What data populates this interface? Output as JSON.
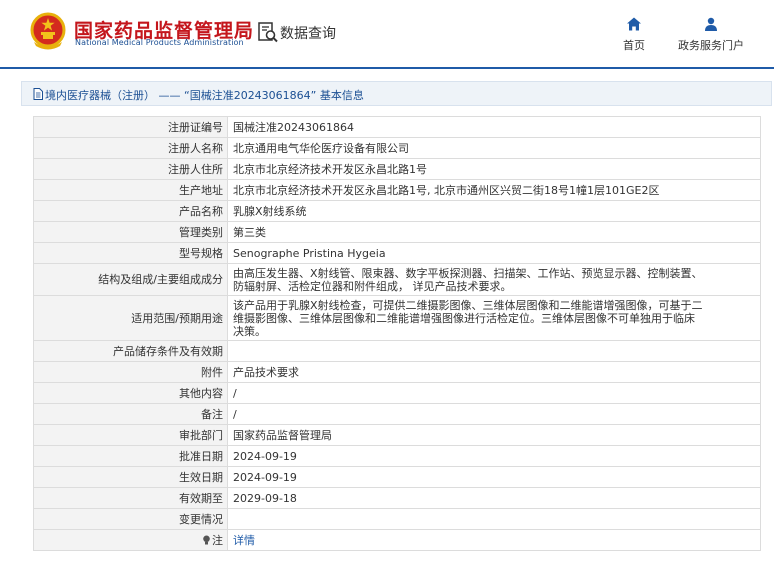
{
  "header": {
    "brand_cn": "国家药品监督管理局",
    "brand_en": "National Medical Products Administration",
    "query_label": "数据查询",
    "nav": {
      "home": "首页",
      "portal": "政务服务门户"
    }
  },
  "breadcrumb": {
    "text": "境内医疗器械（注册） —— “国械注准20243061864” 基本信息"
  },
  "detail": {
    "rows": [
      {
        "label": "注册证编号",
        "value": "国械注准20243061864"
      },
      {
        "label": "注册人名称",
        "value": "北京通用电气华伦医疗设备有限公司"
      },
      {
        "label": "注册人住所",
        "value": "北京市北京经济技术开发区永昌北路1号"
      },
      {
        "label": "生产地址",
        "value": "北京市北京经济技术开发区永昌北路1号, 北京市通州区兴贸二街18号1幢1层101GE2区"
      },
      {
        "label": "产品名称",
        "value": "乳腺X射线系统"
      },
      {
        "label": "管理类别",
        "value": "第三类"
      },
      {
        "label": "型号规格",
        "value": "Senographe Pristina Hygeia"
      },
      {
        "label": "结构及组成/主要组成成分",
        "value_lines": [
          "由高压发生器、X射线管、限束器、数字平板探测器、扫描架、工作站、预览显示器、控制装置、",
          "防辐射屏、活检定位器和附件组成， 详见产品技术要求。"
        ]
      },
      {
        "label": "适用范围/预期用途",
        "value_lines": [
          "该产品用于乳腺X射线检查，可提供二维摄影图像、三维体层图像和二维能谱增强图像，可基于二",
          "维摄影图像、三维体层图像和二维能谱增强图像进行活检定位。三维体层图像不可单独用于临床",
          "决策。"
        ]
      },
      {
        "label": "产品储存条件及有效期",
        "value": ""
      },
      {
        "label": "附件",
        "value": "产品技术要求"
      },
      {
        "label": "其他内容",
        "value": "/"
      },
      {
        "label": "备注",
        "value": "/"
      },
      {
        "label": "审批部门",
        "value": "国家药品监督管理局"
      },
      {
        "label": "批准日期",
        "value": "2024-09-19"
      },
      {
        "label": "生效日期",
        "value": "2024-09-19"
      },
      {
        "label": "有效期至",
        "value": "2029-09-18"
      },
      {
        "label": "变更情况",
        "value": ""
      },
      {
        "label": "注",
        "value": "详情"
      }
    ]
  },
  "colors": {
    "brand_red": "#c4161c",
    "brand_blue": "#1b4f93",
    "accent_blue": "#1f5ba8",
    "label_bg": "#f3f3f3"
  },
  "icons": {
    "emblem": "national-emblem-icon",
    "query": "search-document-icon",
    "home": "home-icon",
    "portal": "user-icon",
    "breadcrumb": "document-icon",
    "note": "lightbulb-icon"
  }
}
